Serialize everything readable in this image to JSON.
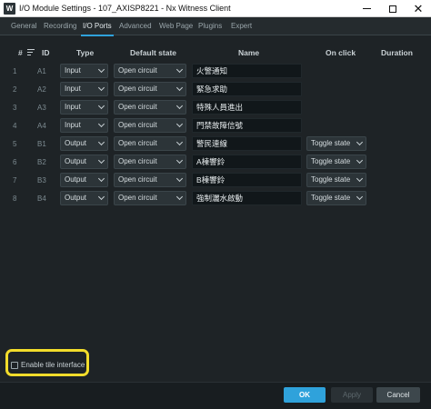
{
  "window": {
    "title": "I/O Module Settings - 107_AXISP8221 - Nx Witness Client",
    "icon_letter": "W",
    "controls": [
      "minimize-icon",
      "maximize-icon",
      "close-icon"
    ]
  },
  "tabs": [
    {
      "label": "General",
      "active": false
    },
    {
      "label": "Recording",
      "active": false
    },
    {
      "label": "I/O Ports",
      "active": true
    },
    {
      "label": "Advanced",
      "active": false
    },
    {
      "label": "Web Page",
      "active": false
    },
    {
      "label": "Plugins",
      "active": false
    },
    {
      "label": "Expert",
      "active": false
    }
  ],
  "table": {
    "headers": {
      "num": "#",
      "id": "ID",
      "type": "Type",
      "default_state": "Default state",
      "name": "Name",
      "on_click": "On click",
      "duration": "Duration"
    },
    "rows": [
      {
        "num": "1",
        "id": "A1",
        "type": "Input",
        "default_state": "Open circuit",
        "name": "火警通知",
        "on_click": ""
      },
      {
        "num": "2",
        "id": "A2",
        "type": "Input",
        "default_state": "Open circuit",
        "name": "緊急求助",
        "on_click": ""
      },
      {
        "num": "3",
        "id": "A3",
        "type": "Input",
        "default_state": "Open circuit",
        "name": "特殊人員進出",
        "on_click": ""
      },
      {
        "num": "4",
        "id": "A4",
        "type": "Input",
        "default_state": "Open circuit",
        "name": "門禁故障信號",
        "on_click": ""
      },
      {
        "num": "5",
        "id": "B1",
        "type": "Output",
        "default_state": "Open circuit",
        "name": "警民連線",
        "on_click": "Toggle state"
      },
      {
        "num": "6",
        "id": "B2",
        "type": "Output",
        "default_state": "Open circuit",
        "name": "A棟響鈴",
        "on_click": "Toggle state"
      },
      {
        "num": "7",
        "id": "B3",
        "type": "Output",
        "default_state": "Open circuit",
        "name": "B棟響鈴",
        "on_click": "Toggle state"
      },
      {
        "num": "8",
        "id": "B4",
        "type": "Output",
        "default_state": "Open circuit",
        "name": "強制灑水啟動",
        "on_click": "Toggle state"
      }
    ]
  },
  "tile_interface": {
    "label": "Enable tile interface",
    "checked": false
  },
  "buttons": {
    "ok": "OK",
    "apply": "Apply",
    "cancel": "Cancel"
  },
  "colors": {
    "accent": "#2fa2db",
    "highlight": "#f2dc2b",
    "background": "#1e2326"
  }
}
